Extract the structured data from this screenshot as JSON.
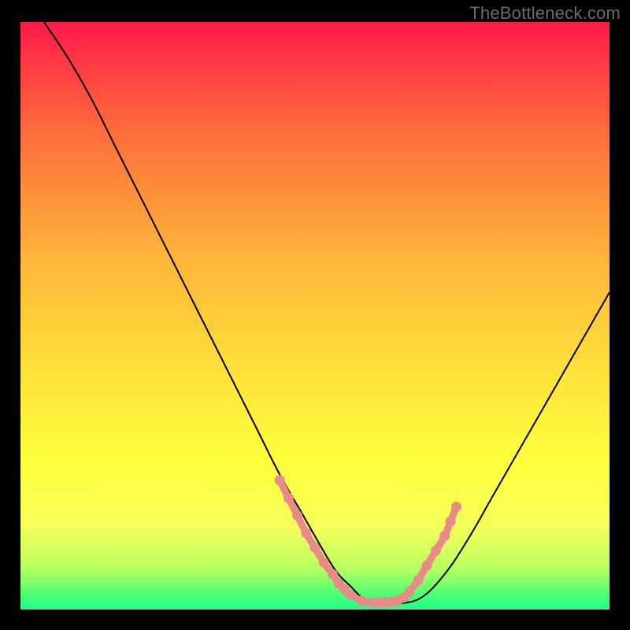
{
  "watermark": "TheBottleneck.com",
  "chart_data": {
    "type": "line",
    "title": "",
    "xlabel": "",
    "ylabel": "",
    "xlim": [
      0,
      100
    ],
    "ylim": [
      0,
      100
    ],
    "grid": false,
    "background_gradient": [
      "#ff1a4a",
      "#ff6a3c",
      "#ffb43a",
      "#ffe23a",
      "#ffff3c",
      "#f5ff5a",
      "#b8ff60",
      "#4cff74",
      "#1eff8c"
    ],
    "series": [
      {
        "name": "bottleneck-curve",
        "color": "#000000",
        "x": [
          4,
          8,
          12,
          16,
          20,
          24,
          28,
          32,
          36,
          40,
          44,
          48,
          52,
          54,
          56,
          58,
          60,
          62,
          64,
          68,
          72,
          76,
          80,
          84,
          88,
          92,
          96,
          100
        ],
        "y": [
          100,
          94,
          87,
          79,
          71,
          63,
          55,
          47,
          39,
          31,
          23,
          16,
          9,
          6,
          4,
          2,
          1,
          1,
          1,
          2,
          6,
          12,
          19,
          26,
          33,
          40,
          47,
          54
        ]
      },
      {
        "name": "highlight-left",
        "color": "#e88a86",
        "marker": "dot",
        "x": [
          44,
          45.5,
          47,
          48.5,
          50,
          51.5,
          53,
          54,
          55
        ],
        "y": [
          22,
          19,
          16,
          13,
          10.5,
          8,
          6,
          4.5,
          3.5
        ]
      },
      {
        "name": "highlight-bottom",
        "color": "#e88a86",
        "marker": "dot",
        "x": [
          56,
          58,
          60,
          61,
          62,
          63,
          64,
          65
        ],
        "y": [
          2.5,
          1.5,
          1.2,
          1.2,
          1.2,
          1.3,
          1.5,
          2
        ]
      },
      {
        "name": "highlight-right",
        "color": "#e88a86",
        "marker": "dot",
        "x": [
          66,
          67.5,
          69,
          70.5,
          72,
          73,
          74
        ],
        "y": [
          3,
          5,
          7.5,
          10,
          12.5,
          15,
          17.5
        ]
      }
    ]
  }
}
